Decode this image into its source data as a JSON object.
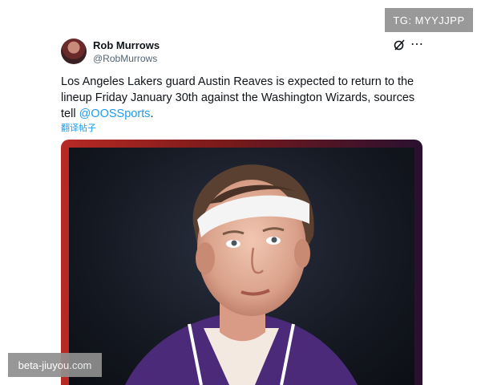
{
  "badges": {
    "top_right": "TG: MYYJJPP",
    "bottom_left": "beta-jiuyou.com"
  },
  "tweet": {
    "author_name": "Rob Murrows",
    "author_handle": "@RobMurrows",
    "text_before_mention": "Los Angeles Lakers guard Austin Reaves is expected to return to the lineup Friday January 30th against the Washington Wizards, sources tell ",
    "mention": "@OOSSports",
    "text_after_mention": ".",
    "translate_label": "翻译帖子",
    "media_description_icon": "photo"
  },
  "colors": {
    "link": "#1d9bf0",
    "text": "#0f1419",
    "muted": "#536471",
    "jersey_purple": "#4b2a7a"
  },
  "icons": {
    "grok": "grok-icon",
    "more": "more-icon"
  }
}
